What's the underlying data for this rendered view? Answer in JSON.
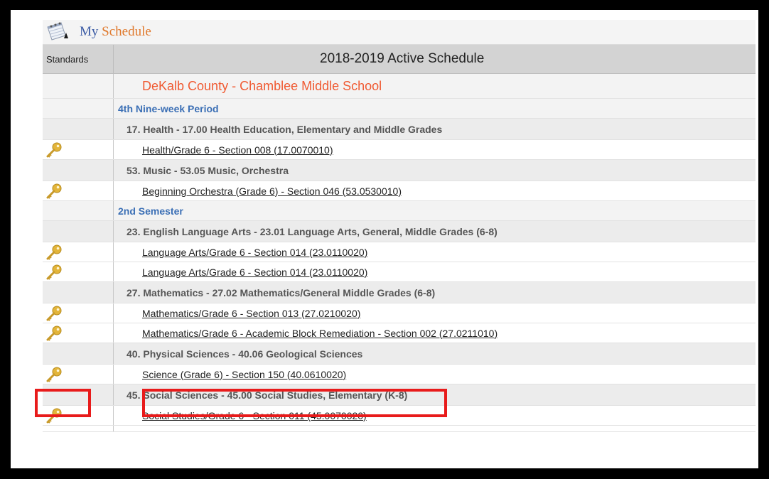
{
  "widget": {
    "title_part1": "My",
    "title_part2": "Schedule",
    "calendar_icon": "calendar-icon"
  },
  "table": {
    "col1_header": "Standards",
    "col2_header": "2018-2019 Active Schedule",
    "school": "DeKalb County - Chamblee Middle School"
  },
  "rows": [
    {
      "type": "period",
      "text": "4th Nine-week Period"
    },
    {
      "type": "subject",
      "text": "17. Health - 17.00 Health Education, Elementary and Middle Grades"
    },
    {
      "type": "course",
      "text": "Health/Grade 6  - Section 008 (17.0070010)"
    },
    {
      "type": "subject",
      "text": "53. Music - 53.05 Music, Orchestra"
    },
    {
      "type": "course",
      "text": "Beginning Orchestra (Grade 6) - Section 046 (53.0530010)"
    },
    {
      "type": "period",
      "text": "2nd Semester"
    },
    {
      "type": "subject",
      "text": "23. English Language Arts - 23.01 Language Arts, General, Middle Grades (6-8)"
    },
    {
      "type": "course",
      "text": "Language Arts/Grade 6  - Section 014 (23.0110020)"
    },
    {
      "type": "course",
      "text": "Language Arts/Grade 6  - Section 014 (23.0110020)"
    },
    {
      "type": "subject",
      "text": "27. Mathematics - 27.02 Mathematics/General Middle Grades (6-8)"
    },
    {
      "type": "course",
      "text": "Mathematics/Grade 6  - Section 013 (27.0210020)"
    },
    {
      "type": "course",
      "text": "Mathematics/Grade 6 - Academic Block Remediation  - Section 002 (27.0211010)"
    },
    {
      "type": "subject",
      "text": "40. Physical Sciences - 40.06 Geological Sciences"
    },
    {
      "type": "course",
      "text": "Science (Grade 6)  - Section 150 (40.0610020)",
      "highlighted": true
    },
    {
      "type": "subject",
      "text": "45. Social Sciences - 45.00 Social Studies, Elementary (K-8)"
    },
    {
      "type": "course",
      "text": "Social Studies/Grade 6  - Section 011 (45.0070020)"
    }
  ],
  "icons": {
    "standards_key": "key-icon"
  },
  "colors": {
    "title_blue": "#3b5ba5",
    "title_orange": "#e07a2e",
    "school_red": "#f05a32",
    "period_blue": "#3b6fb5",
    "highlight_red": "#e81b1b",
    "key_gold": "#e3b53a"
  }
}
